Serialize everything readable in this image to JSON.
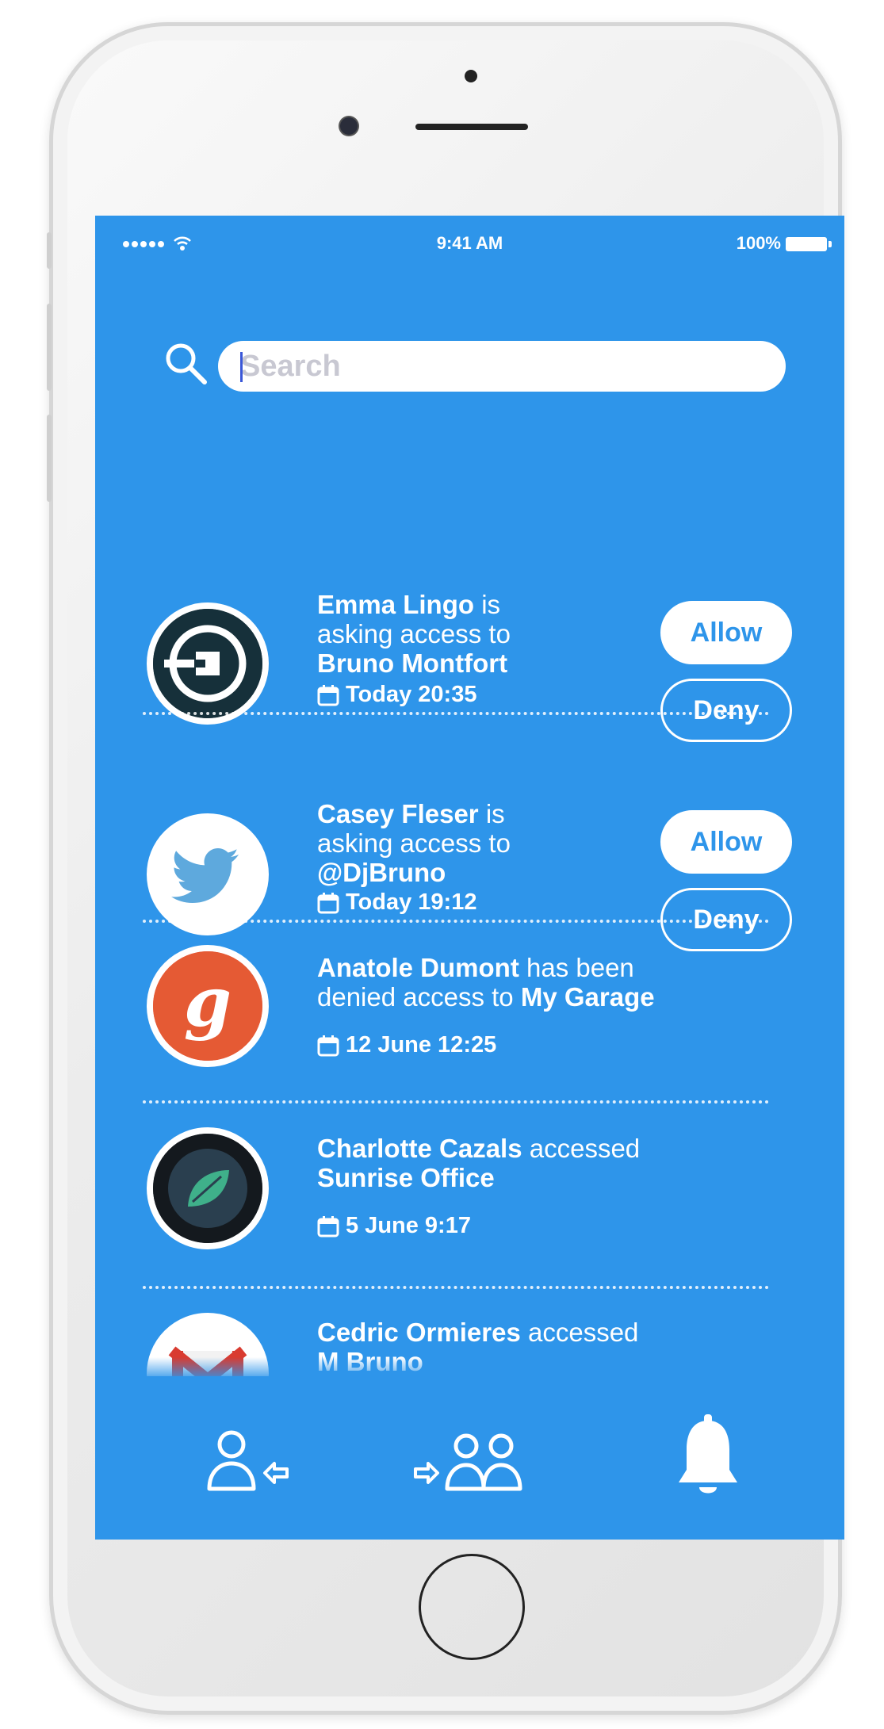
{
  "status_bar": {
    "time": "9:41 AM",
    "battery": "100%"
  },
  "search": {
    "placeholder": "Search",
    "value": ""
  },
  "requests": [
    {
      "avatar_icon": "uber-icon",
      "name": "Emma Lingo",
      "mid_line_1": "is",
      "mid_line_2": "asking access to",
      "target": "Bruno Montfort",
      "date": "Today 20:35",
      "allow_label": "Allow",
      "deny_label": "Deny"
    },
    {
      "avatar_icon": "twitter-icon",
      "name": "Casey Fleser",
      "mid_line_1": "is",
      "mid_line_2": "asking access to",
      "target": "@DjBruno",
      "date": "Today 19:12",
      "allow_label": "Allow",
      "deny_label": "Deny"
    }
  ],
  "events": [
    {
      "avatar_icon": "garage-g-icon",
      "name": "Anatole Dumont",
      "text_1": "has been",
      "text_2": "denied access to",
      "target": "My Garage",
      "date": "12 June 12:25"
    },
    {
      "avatar_icon": "leaf-icon",
      "name": "Charlotte Cazals",
      "text_1": "accessed",
      "target": "Sunrise Office",
      "date": "5 June 9:17"
    },
    {
      "avatar_icon": "gmail-icon",
      "name": "Cedric Ormieres",
      "text_1": "accessed",
      "target": "M Bruno"
    }
  ],
  "tab_bar": {
    "tabs": [
      "user-incoming-icon",
      "group-outgoing-icon",
      "bell-icon"
    ]
  },
  "colors": {
    "screen_background": "#2e95ea",
    "button_text": "#2e95ea"
  }
}
